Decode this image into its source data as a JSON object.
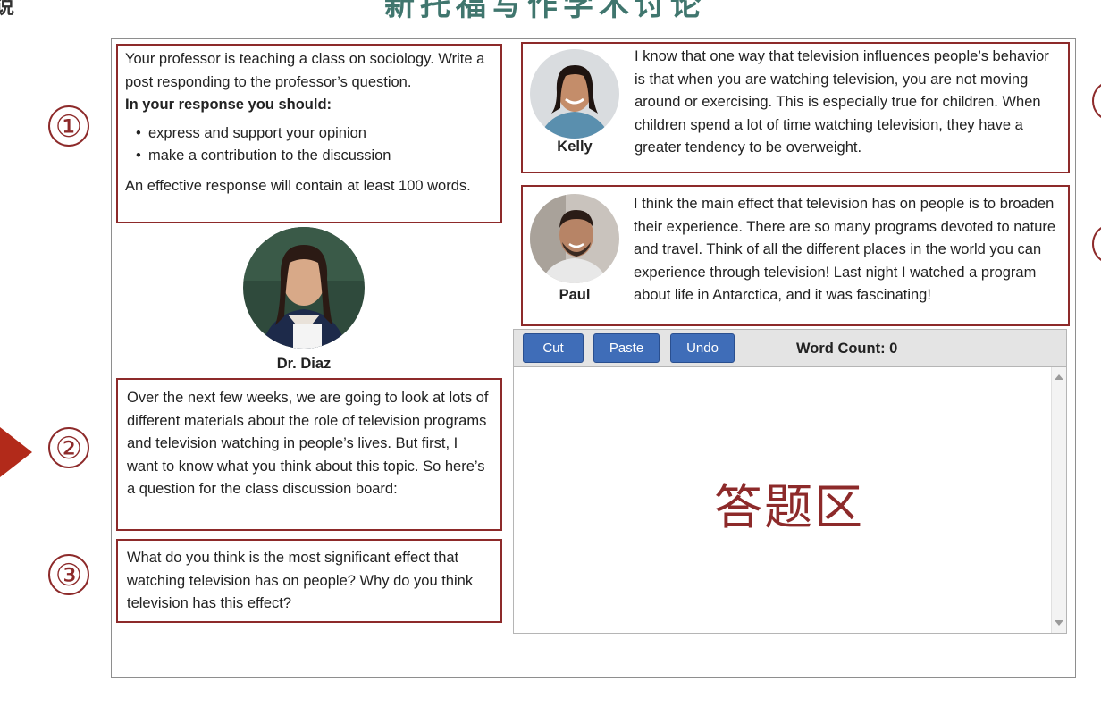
{
  "header": {
    "title_fragment": "新托福写作学术讨论",
    "corner_glyph": "说"
  },
  "markers": {
    "m1": "①",
    "m2": "②",
    "m3": "③"
  },
  "instructions": {
    "intro": "Your professor is teaching a class on sociology. Write a post responding to the professor’s question.",
    "heading": "In your response you should:",
    "bullets": [
      "express and support your opinion",
      "make a contribution to the discussion"
    ],
    "footer": "An effective response will contain at least 100 words."
  },
  "professor": {
    "name": "Dr. Diaz",
    "intro": "Over the next few weeks, we are going to look at lots of different materials about the role of television programs and television watching in people’s lives. But first, I want to know what you think about this topic. So here’s a question for the class discussion board:",
    "question": "What do you think is the most significant effect that watching television has on people? Why do you think television has this effect?"
  },
  "students": [
    {
      "name": "Kelly",
      "post": "I know that one way that television influences people’s behavior is that when you are watching television, you are not moving around or exercising. This is especially true for children. When children spend a lot of time watching television, they have a greater tendency to be overweight."
    },
    {
      "name": "Paul",
      "post": "I think the main effect that television has on people is to broaden their experience. There are so many programs devoted to nature and travel. Think of all the different places in the world you can experience through television! Last night I watched a program about life in Antarctica, and it was fascinating!"
    }
  ],
  "editor": {
    "buttons": {
      "cut": "Cut",
      "paste": "Paste",
      "undo": "Undo"
    },
    "word_count": "Word Count: 0",
    "watermark": "答题区",
    "value": ""
  },
  "colors": {
    "accent_red": "#8d2a2a",
    "button_blue": "#3f6db8",
    "arrow_red": "#b22a1a"
  }
}
